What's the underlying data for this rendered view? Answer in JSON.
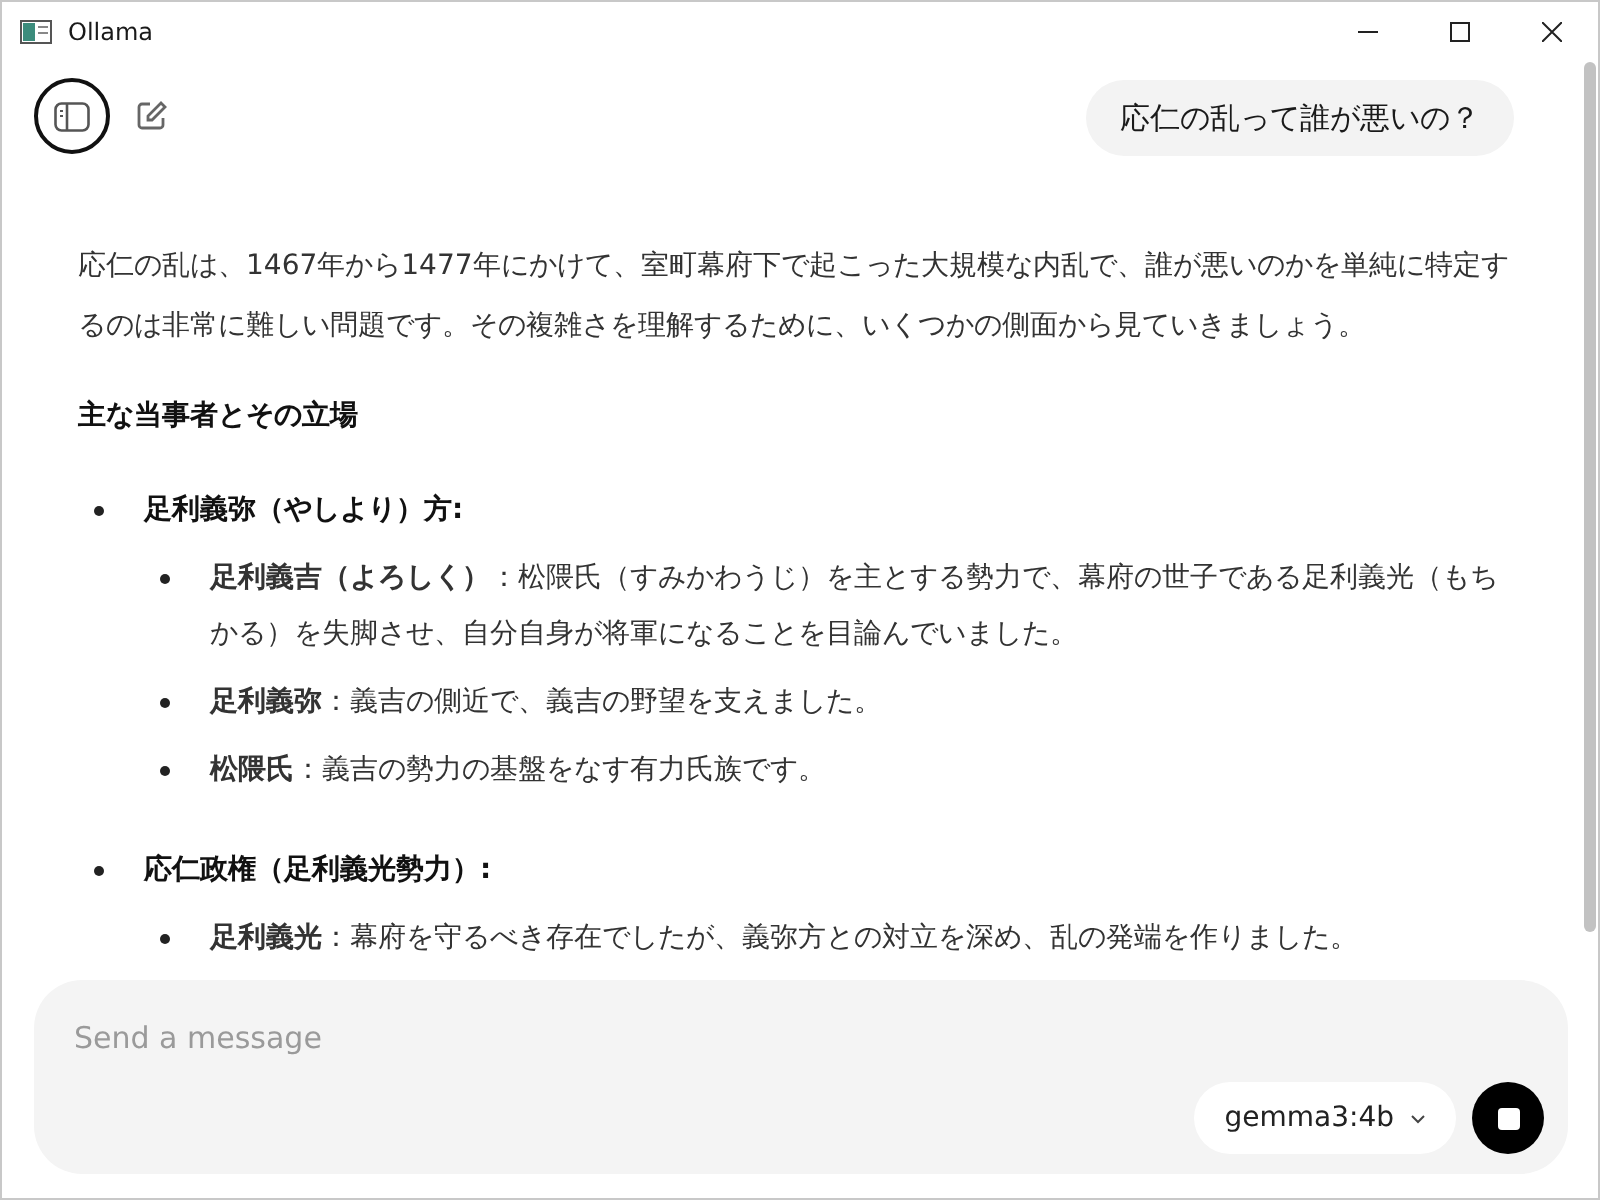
{
  "window": {
    "title": "Ollama"
  },
  "user_message": "応仁の乱って誰が悪いの？",
  "response": {
    "intro": "応仁の乱は、1467年から1477年にかけて、室町幕府下で起こった大規模な内乱で、誰が悪いのかを単純に特定するのは非常に難しい問題です。その複雑さを理解するために、いくつかの側面から見ていきましょう。",
    "heading": "主な当事者とその立場",
    "sections": [
      {
        "title": "足利義弥（やしより）方:",
        "items": [
          "**足利義吉（よろしく）**：松隈氏（すみかわうじ）を主とする勢力で、幕府の世子である足利義光（もちかる）を失脚させ、自分自身が将軍になることを目論んでいました。",
          "**足利義弥**：義吉の側近で、義吉の野望を支えました。",
          "**松隈氏**：義吉の勢力の基盤をなす有力氏族です。"
        ]
      },
      {
        "title": "応仁政権（足利義光勢力）:",
        "items": [
          "**足利義光**：幕府を守るべき存在でしたが、義弥方との対立を深め、乱の発端を作りました。"
        ]
      }
    ]
  },
  "composer": {
    "placeholder": "Send a message",
    "model": "gemma3:4b"
  }
}
